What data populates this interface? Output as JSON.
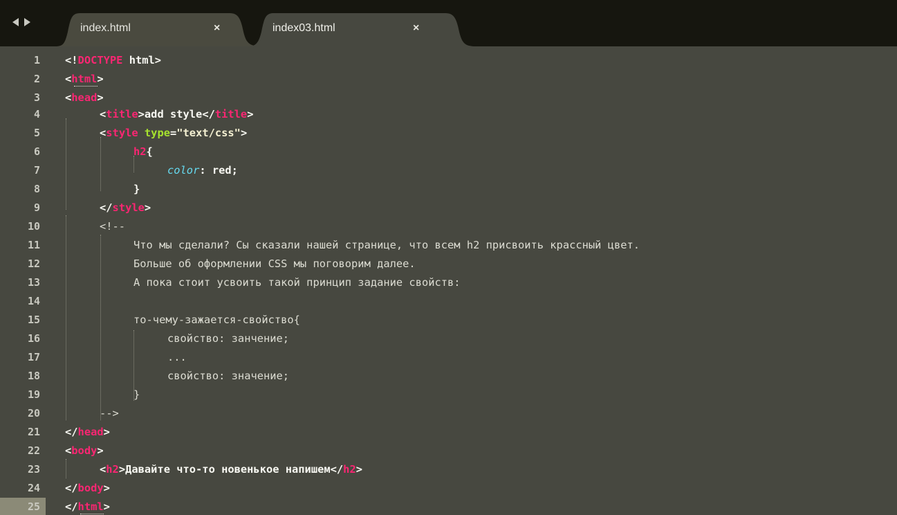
{
  "tabs": [
    {
      "label": "index.html",
      "close": "×",
      "active": false
    },
    {
      "label": "index03.html",
      "close": "×",
      "active": true
    }
  ],
  "editor": {
    "line_numbers": [
      "1",
      "2",
      "3",
      "4",
      "5",
      "6",
      "7",
      "8",
      "9",
      "10",
      "11",
      "12",
      "13",
      "14",
      "15",
      "16",
      "17",
      "18",
      "19",
      "20",
      "21",
      "22",
      "23",
      "24",
      "25"
    ],
    "current_line": "25",
    "code": {
      "doctype_open": "<!",
      "doctype_kw": "DOCTYPE",
      "doctype_rest": " html>",
      "html_tag": "html",
      "head_tag": "head",
      "title_tag": "title",
      "title_text": "add style",
      "style_tag": "style",
      "type_attr": "type",
      "type_value": "\"text/css\"",
      "selector": "h2",
      "brace_open": "{",
      "property": "color",
      "value": ": red;",
      "brace_close": "}",
      "comment_open": "<!--",
      "comment_line1": "Что мы сделали? Сы сказали нашей странице, что всем h2 присвоить крассный цвет.",
      "comment_line2": "Больше об оформлении CSS мы поговорим далее.",
      "comment_line3": "А пока стоит усвоить такой принцип задание свойств:",
      "comment_line5": "то-чему-зажается-свойство{",
      "comment_line6": "свойство: занчение;",
      "comment_line7": "...",
      "comment_line8": "свойство: значение;",
      "comment_line9": "}",
      "comment_close": "-->",
      "body_tag": "body",
      "h2_tag": "h2",
      "h2_text": "Давайте что-то новенькое напишем"
    }
  },
  "colors": {
    "background": "#474840",
    "tab_bar": "#16160f",
    "tag": "#f92672",
    "attribute": "#a6e22e",
    "property": "#66d9ef",
    "comment": "#dcdcd2",
    "current_line_gutter": "#8b8a77"
  }
}
